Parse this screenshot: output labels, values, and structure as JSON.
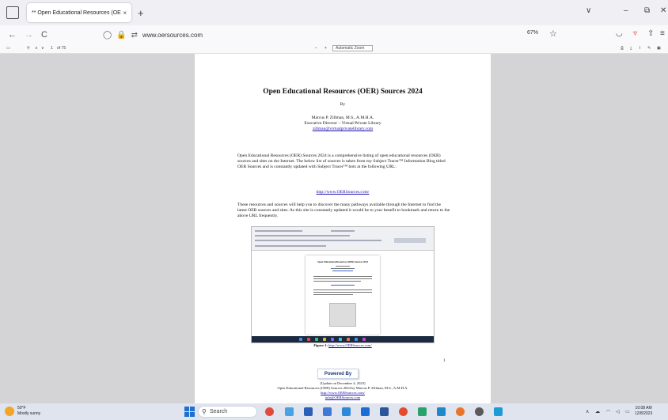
{
  "browser": {
    "tab_title": "** Open Educational Resources (OE",
    "tab_close": "×",
    "new_tab": "+",
    "url": "www.oersources.com",
    "zoom": "67%",
    "win_controls": {
      "dropdown": "∨",
      "minimize": "–",
      "restore": "⧉",
      "close": "✕"
    },
    "nav": {
      "back": "←",
      "forward": "→",
      "reload": "C"
    }
  },
  "pdf_toolbar": {
    "page_current": "1",
    "page_total": "of 75",
    "zoom_minus": "–",
    "zoom_plus": "+",
    "zoom_mode": "Automatic Zoom"
  },
  "document": {
    "title": "Open Educational Resources (OER) Sources 2024",
    "by": "By",
    "author": "Marcus P. Zillman, M.S., A.M.H.A.",
    "position": "Executive Director – Virtual Private Library",
    "email": "zillman@virtualprivatelibrary.com",
    "intro": "Open Educational Resources (OER) Sources 2024 is a comprehensive listing of open educational resources (OER) sources and sites on the Internet. The below list of sources is taken from my Subject Tracer™ Information Blog titled OER Sources and is constantly updated with Subject Tracer™ bots at the following URL:",
    "url_link": "http://www.OERSources.com/",
    "para2": "These resources and sources will help you to discover the many pathways available through the Internet to find the latest OER sources and sites. As this site is constantly updated it would be to your benefit to bookmark and return to the above URL frequently.",
    "embedded_title": "Open Educational Resources (OER) Sources 2024",
    "figure_label": "Figure 1:",
    "figure_link": "http://www.OERSources.com/",
    "page_number": "1",
    "powered_by": "Powered By",
    "update_note": "[Update on December 4, 2023]",
    "footer_line": "Open Educational Resources (OER) Sources 2024 by Marcus P. Zillman, M.S., A.M.H.A.",
    "footer_url": "http://www.OERSources.com/",
    "footer_email": "info@OERSources.com"
  },
  "taskbar": {
    "temp": "50°F",
    "weather": "Mostly sunny",
    "search": "Search",
    "time": "10:08 AM",
    "date": "12/8/2023"
  }
}
